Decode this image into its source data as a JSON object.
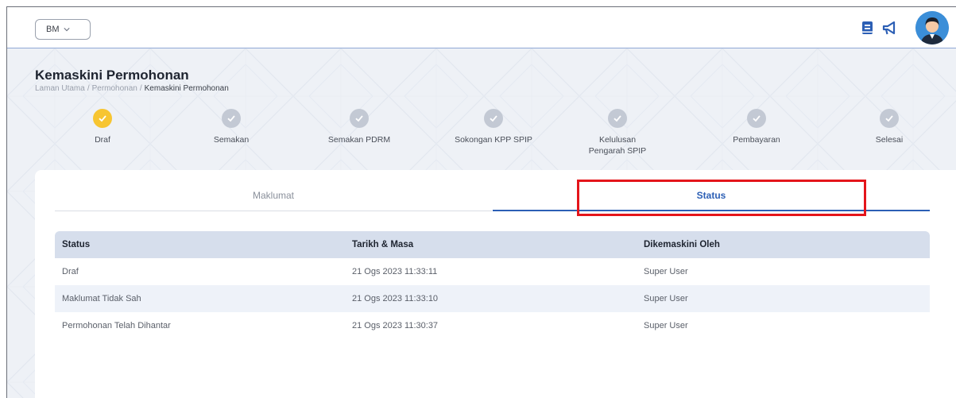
{
  "header": {
    "language": "BM",
    "colors": {
      "accent": "#2c5fb5",
      "active_step": "#f7c531",
      "step_done": "#c3c9d4",
      "highlight": "#e4151b"
    }
  },
  "page": {
    "title": "Kemaskini Permohonan",
    "breadcrumb": [
      "Laman Utama",
      "Permohonan",
      "Kemaskini Permohonan"
    ],
    "breadcrumb_sep": "/"
  },
  "steps": [
    {
      "label": "Draf",
      "state": "active"
    },
    {
      "label": "Semakan",
      "state": "done"
    },
    {
      "label": "Semakan PDRM",
      "state": "done"
    },
    {
      "label": "Sokongan KPP SPIP",
      "state": "done"
    },
    {
      "label": "Kelulusan Pengarah SPIP",
      "state": "done"
    },
    {
      "label": "Pembayaran",
      "state": "done"
    },
    {
      "label": "Selesai",
      "state": "done"
    }
  ],
  "tabs": [
    {
      "label": "Maklumat"
    },
    {
      "label": "Status"
    }
  ],
  "table": {
    "headers": [
      "Status",
      "Tarikh & Masa",
      "Dikemaskini Oleh"
    ],
    "rows": [
      [
        "Draf",
        "21 Ogs 2023 11:33:11",
        "Super User"
      ],
      [
        "Maklumat Tidak Sah",
        "21 Ogs 2023 11:33:10",
        "Super User"
      ],
      [
        "Permohonan Telah Dihantar",
        "21 Ogs 2023 11:30:37",
        "Super User"
      ]
    ]
  }
}
